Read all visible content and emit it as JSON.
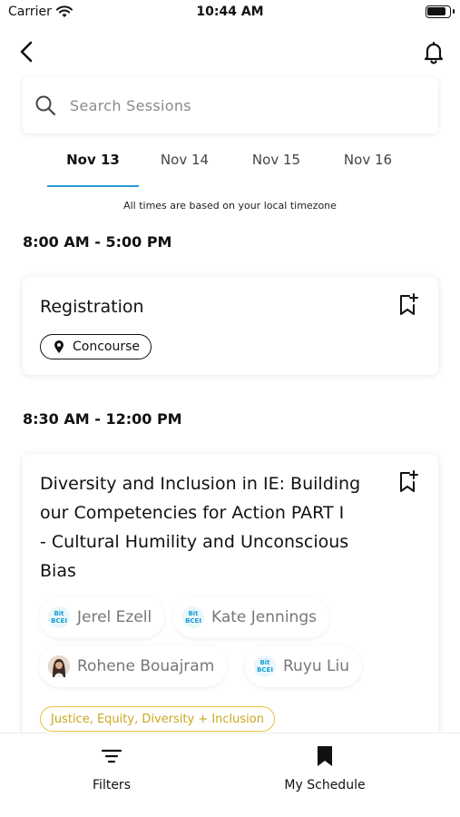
{
  "status_bar": {
    "carrier": "Carrier",
    "time": "10:44 AM"
  },
  "search": {
    "placeholder": "Search Sessions",
    "value": ""
  },
  "tabs": [
    {
      "label": "Nov 13",
      "active": true
    },
    {
      "label": "Nov 14",
      "active": false
    },
    {
      "label": "Nov 15",
      "active": false
    },
    {
      "label": "Nov 16",
      "active": false
    }
  ],
  "timezone_note": "All times are based on your local timezone",
  "sessions": [
    {
      "time": "8:00 AM - 5:00 PM",
      "title": "Registration",
      "location": "Concourse"
    },
    {
      "time": "8:30 AM - 12:00 PM",
      "title_lines": [
        "Diversity and Inclusion in IE: Building",
        "our Competencies for Action PART I",
        "- Cultural Humility and Unconscious",
        "Bias"
      ],
      "speakers": [
        {
          "name": "Jerel Ezell",
          "avatar": "logo"
        },
        {
          "name": "Kate Jennings",
          "avatar": "logo"
        },
        {
          "name": "Rohene Bouajram",
          "avatar": "photo"
        },
        {
          "name": "Ruyu Liu",
          "avatar": "logo"
        }
      ],
      "track": "Justice, Equity, Diversity + Inclusion"
    }
  ],
  "avatar_logo_text": [
    "Bit",
    "BCEI"
  ],
  "bottom_nav": {
    "filters": "Filters",
    "my_schedule": "My Schedule"
  },
  "colors": {
    "tab_underline": "#2a9fd6",
    "track_tag": "#e3c33a",
    "text": "#111111",
    "speaker_text": "#777777"
  },
  "icons": [
    "back-arrow-icon",
    "bell-icon",
    "search-icon",
    "bookmark-plus-icon",
    "location-pin-icon",
    "filter-icon",
    "bookmark-icon"
  ]
}
